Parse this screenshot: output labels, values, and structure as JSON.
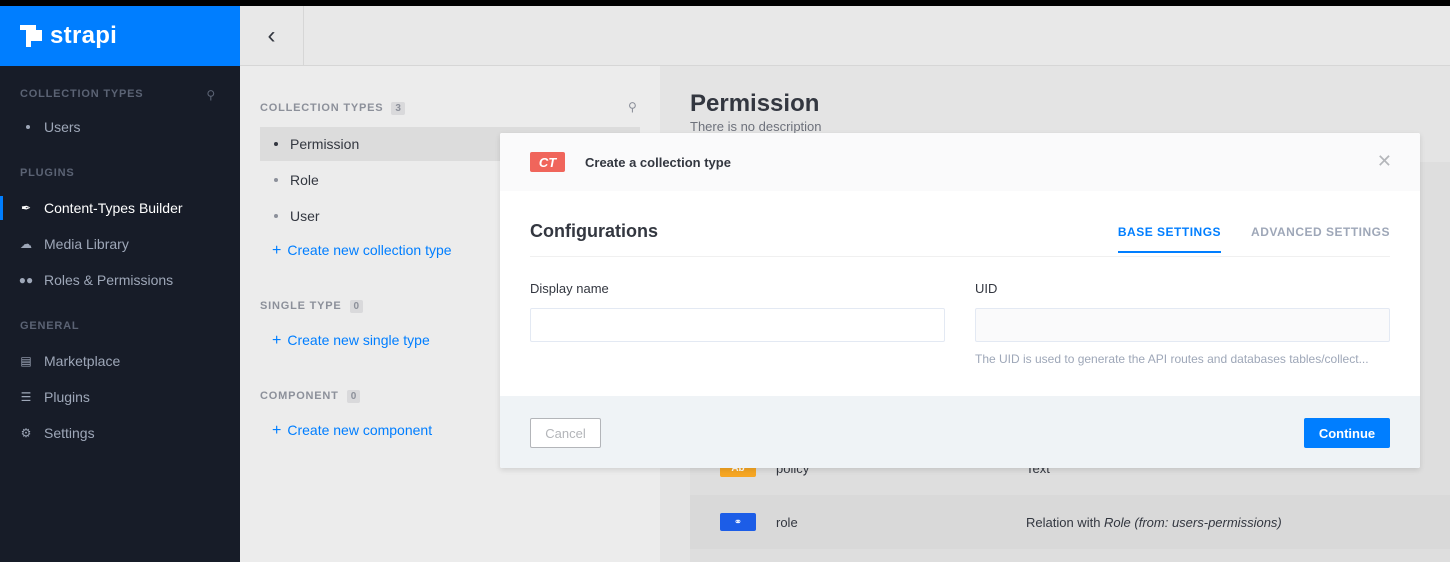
{
  "brand": {
    "name": "strapi"
  },
  "left_nav": {
    "collection_types_title": "COLLECTION TYPES",
    "collection_items": [
      {
        "label": "Users"
      }
    ],
    "plugins_title": "PLUGINS",
    "plugin_items": [
      {
        "label": "Content-Types Builder",
        "icon": "brush-icon",
        "active": true
      },
      {
        "label": "Media Library",
        "icon": "cloud-icon",
        "active": false
      },
      {
        "label": "Roles & Permissions",
        "icon": "users-icon",
        "active": false
      }
    ],
    "general_title": "GENERAL",
    "general_items": [
      {
        "label": "Marketplace",
        "icon": "basket-icon"
      },
      {
        "label": "Plugins",
        "icon": "list-icon"
      },
      {
        "label": "Settings",
        "icon": "gear-icon"
      }
    ]
  },
  "topbar": {
    "back_icon": "chevron-left-icon"
  },
  "ctb_sidebar": {
    "collection_title": "COLLECTION TYPES",
    "collection_count": "3",
    "collection_items": [
      "Permission",
      "Role",
      "User"
    ],
    "create_collection": "Create new collection type",
    "single_title": "SINGLE TYPE",
    "single_count": "0",
    "create_single": "Create new single type",
    "component_title": "COMPONENT",
    "component_count": "0",
    "create_component": "Create new component"
  },
  "main": {
    "title": "Permission",
    "description": "There is no description",
    "rows": [
      {
        "badge": "Ab",
        "badge_color": "#f6a623",
        "name": "policy",
        "type": "Text",
        "type_em": ""
      },
      {
        "badge": "⚭",
        "badge_color": "#1c5de7",
        "name": "role",
        "type": "Relation with ",
        "type_em": "Role (from: users-permissions)"
      }
    ]
  },
  "modal": {
    "badge": "CT",
    "title": "Create a collection type",
    "subtitle": "Configurations",
    "tabs": [
      "BASE SETTINGS",
      "ADVANCED SETTINGS"
    ],
    "display_name_label": "Display name",
    "display_name_value": "",
    "uid_label": "UID",
    "uid_value": "",
    "uid_hint": "The UID is used to generate the API routes and databases tables/collect...",
    "cancel_label": "Cancel",
    "continue_label": "Continue"
  },
  "colors": {
    "accent": "#007eff",
    "nav_bg": "#171c28",
    "ct_badge": "#f0655b"
  }
}
